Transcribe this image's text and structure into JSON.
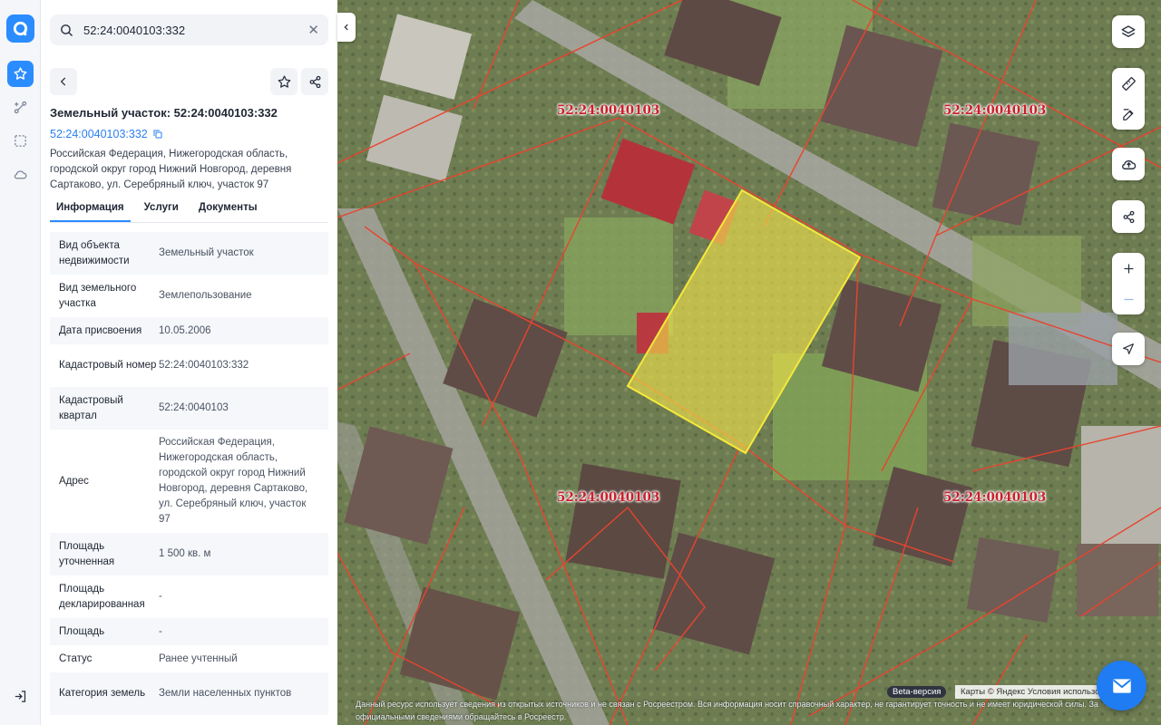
{
  "search": {
    "value": "52:24:0040103:332"
  },
  "object": {
    "title": "Земельный участок: 52:24:0040103:332",
    "cadastral_link": "52:24:0040103:332",
    "address": "Российская Федерация, Нижегородская область, городской округ город Нижний Новгород, деревня Сартаково, ул. Серебряный ключ, участок 97"
  },
  "tabs": [
    {
      "label": "Информация",
      "active": true
    },
    {
      "label": "Услуги",
      "active": false
    },
    {
      "label": "Документы",
      "active": false
    }
  ],
  "info_rows": [
    {
      "key": "Вид объекта недвижимости",
      "value": "Земельный участок"
    },
    {
      "key": "Вид земельного участка",
      "value": "Землепользование"
    },
    {
      "key": "Дата присвоения",
      "value": "10.05.2006"
    },
    {
      "key": "Кадастровый номер",
      "value": "52:24:0040103:332"
    },
    {
      "key": "Кадастровый квартал",
      "value": "52:24:0040103"
    },
    {
      "key": "Адрес",
      "value": "Российская Федерация, Нижегородская область, городской округ город Нижний Новгород, деревня Сартаково, ул. Серебряный ключ, участок 97"
    },
    {
      "key": "Площадь уточненная",
      "value": "1 500 кв. м"
    },
    {
      "key": "Площадь декларированная",
      "value": "-"
    },
    {
      "key": "Площадь",
      "value": "-"
    },
    {
      "key": "Статус",
      "value": "Ранее учтенный"
    },
    {
      "key": "Категория земель",
      "value": "Земли населенных пунктов"
    }
  ],
  "map": {
    "quarter_labels": [
      "52:24:0040103",
      "52:24:0040103",
      "52:24:0040103",
      "52:24:0040103"
    ],
    "beta_label": "Beta-версия",
    "copyright": "Карты © Яндекс   Условия использования",
    "disclaimer": "Данный ресурс использует сведения из открытых источников и не связан с Росреестром. Вся информация носит справочный характер, не гарантирует точность и не имеет юридической силы. За официальными сведениями обращайтесь в Росреестр."
  },
  "colors": {
    "accent": "#2b8cff",
    "cadastral_line": "#e8442e",
    "parcel_fill": "#f2e34a",
    "label_red": "#c8202a"
  },
  "icons": [
    "logo-icon",
    "star-icon",
    "route-icon",
    "select-area-icon",
    "cloud-icon",
    "logout-icon",
    "search-icon",
    "close-icon",
    "chevron-left-icon",
    "share-icon",
    "copy-icon",
    "layers-icon",
    "ruler-icon",
    "edit-icon",
    "upload-icon",
    "plus-icon",
    "minus-icon",
    "locate-icon",
    "mail-icon"
  ]
}
